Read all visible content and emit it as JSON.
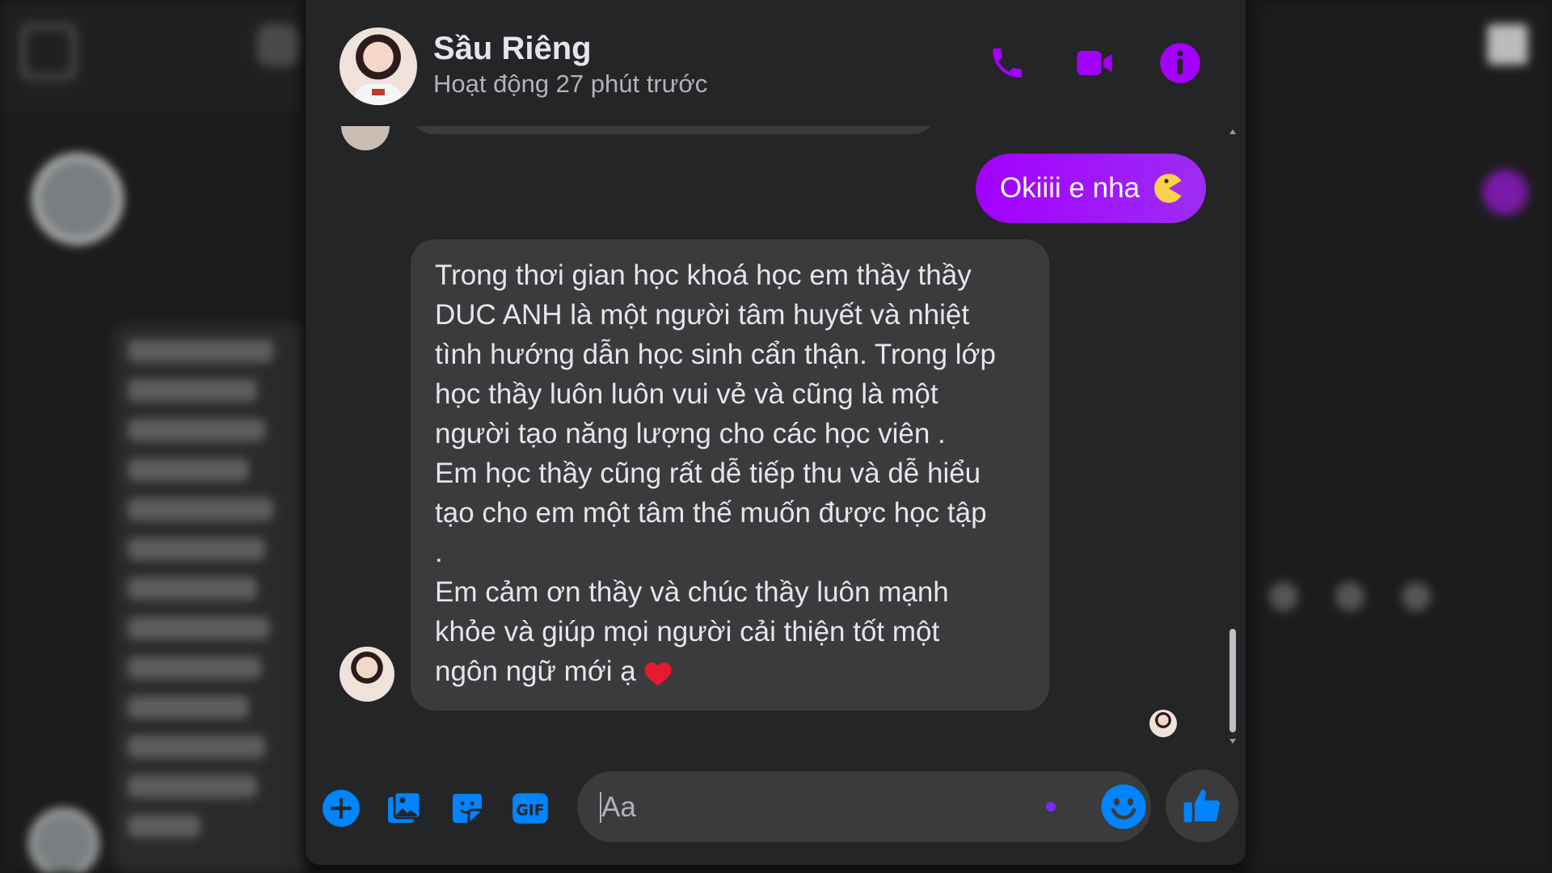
{
  "header": {
    "name": "Sầu Riêng",
    "status": "Hoạt động 27 phút trước"
  },
  "messages": {
    "sent_text": "Okiiii e nha",
    "received_text": "Trong thơi gian học khoá học em thầy thầy\nDUC ANH là một người tâm huyết và nhiệt\ntình hướng dẫn học sinh cẩn thận. Trong lớp\nhọc thầy luôn luôn vui vẻ và cũng là một\nngười tạo năng lượng cho các học viên .\nEm học thầy cũng rất dễ tiếp thu và dễ hiểu\ntạo cho em một tâm thế muốn được học tập\n.\nEm cảm ơn thầy và chúc thầy luôn mạnh\nkhỏe và giúp mọi người cải thiện tốt một\nngôn ngữ mới ạ"
  },
  "composer": {
    "placeholder": "Aa"
  },
  "colors": {
    "accent": "#a200ff",
    "icon_blue": "#0084ff",
    "bubble_received": "#3a3b3c",
    "window_bg": "#242526"
  },
  "icons": [
    "phone-icon",
    "video-icon",
    "info-icon",
    "plus-icon",
    "image-icon",
    "sticker-icon",
    "gif-icon",
    "smile-icon",
    "thumbs-up-icon",
    "heart-icon",
    "pacman-emoji-icon"
  ]
}
